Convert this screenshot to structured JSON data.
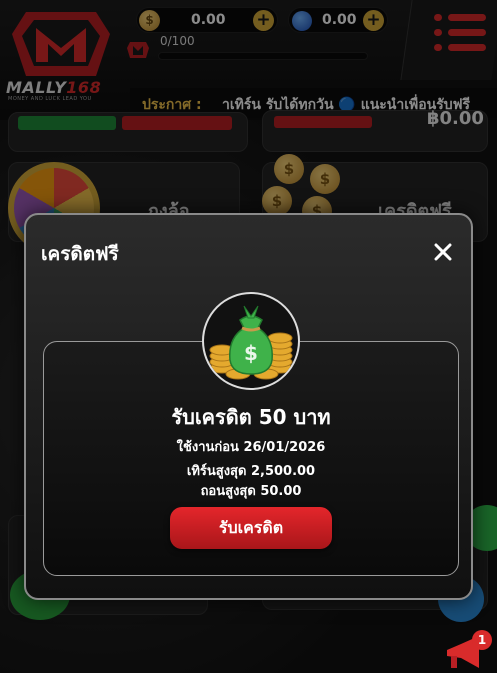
{
  "header": {
    "logo_main": "MALLY",
    "logo_accent": "168",
    "logo_tagline": "MONEY AND LUCK LEAD YOU",
    "credit_balance": "0.00",
    "gem_balance": "0.00",
    "level_progress": "0/100",
    "announce_label": "ประกาศ :",
    "announce_text": "าเทิร์น รับได้ทุกวัน 🔵 แนะนำเพื่อนรับฟรี"
  },
  "background": {
    "wheel_label": "กงล้อ",
    "free_credit_label": "เครดิตฟรี",
    "balance_display": "฿0.00"
  },
  "modal": {
    "title": "เครดิตฟรี",
    "card": {
      "title": "รับเครดิต 50 บาท",
      "expiry": "ใช้งานก่อน 26/01/2026",
      "max_turnover": "เทิร์นสูงสุด 2,500.00",
      "max_withdraw": "ถอนสูงสุด 50.00",
      "claim_button": "รับเครดิต"
    }
  },
  "notifications": {
    "count": "1"
  },
  "colors": {
    "brand_red": "#d92b2b",
    "gold": "#d4a93a",
    "claim_button": "#e4262b"
  }
}
